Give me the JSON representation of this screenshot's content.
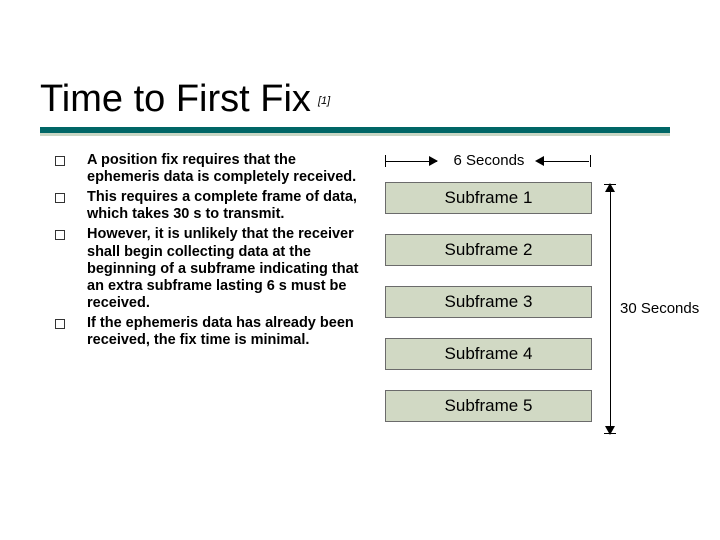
{
  "title": "Time to First Fix",
  "ref_mark": "[1]",
  "bullets": [
    "A position fix requires that the ephemeris data is completely received.",
    "This requires a complete frame of data, which takes 30 s to transmit.",
    "However, it is unlikely that the receiver shall begin collecting data at the beginning of a subframe indicating that an extra subframe lasting 6 s must be received.",
    "If the ephemeris data has already been received, the fix time is minimal."
  ],
  "diagram": {
    "top_label": "6 Seconds",
    "side_label": "30 Seconds",
    "subframes": [
      "Subframe 1",
      "Subframe 2",
      "Subframe 3",
      "Subframe 4",
      "Subframe 5"
    ]
  }
}
